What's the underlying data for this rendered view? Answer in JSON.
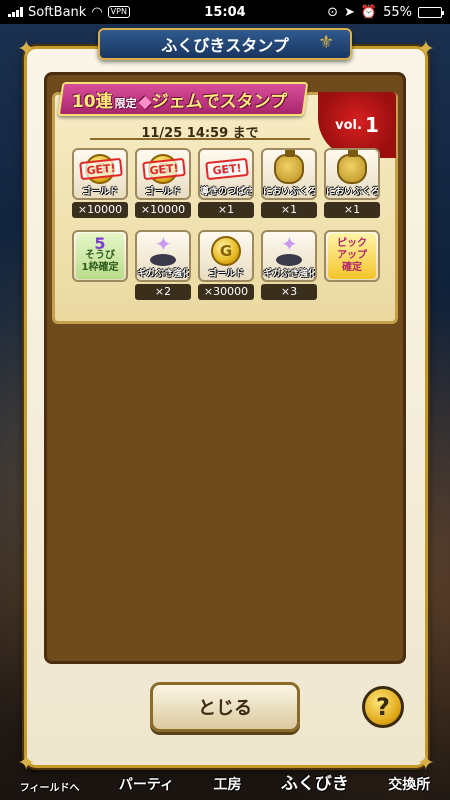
{
  "status_bar": {
    "carrier": "SoftBank",
    "vpn": "VPN",
    "time": "15:04",
    "battery": "55%",
    "battery_level": 0.55
  },
  "dialog": {
    "title": "ふくびきスタンプ",
    "banner": {
      "part1": "10連",
      "part2": "限定",
      "part3": "ジェムでスタンプ"
    },
    "deadline": "11/25 14:59 まで",
    "vol_label": "vol.",
    "vol_number": "1",
    "close_label": "とじる",
    "help_label": "?"
  },
  "stamps": [
    {
      "icon": "gold-coin-icon",
      "got": true,
      "label": "ゴールド",
      "qty": "×10000"
    },
    {
      "icon": "gold-coin-icon",
      "got": true,
      "label": "ゴールド",
      "qty": "×10000"
    },
    {
      "icon": "guiding-wings-icon",
      "got": true,
      "label": "導きのつばさ",
      "qty": "×1"
    },
    {
      "icon": "scent-bag-icon",
      "got": false,
      "label": "においぶくろ",
      "qty": "×1"
    },
    {
      "icon": "scent-bag-icon",
      "got": false,
      "label": "においぶくろ",
      "qty": "×1"
    },
    {
      "icon": "five-star-guarantee-icon",
      "got": false,
      "label": "",
      "qty": ""
    },
    {
      "icon": "giga-upgrade-stone-icon",
      "got": false,
      "label": "ギガぶき強化石",
      "qty": "×2"
    },
    {
      "icon": "gold-coin-icon",
      "got": false,
      "label": "ゴールド",
      "qty": "×30000"
    },
    {
      "icon": "giga-upgrade-stone-icon",
      "got": false,
      "label": "ギガぶき強化石",
      "qty": "×3"
    },
    {
      "icon": "pickup-guarantee-icon",
      "got": false,
      "label": "",
      "qty": ""
    }
  ],
  "stamp_text": {
    "get": "GET!",
    "coin_letter": "G",
    "five_star_num": "5",
    "five_star_line1": "そうび",
    "five_star_line2": "1枠確定",
    "pickup_line1": "ピック",
    "pickup_line2": "アップ",
    "pickup_line3": "確定"
  },
  "bottom_nav": [
    {
      "label": "フィールドへ"
    },
    {
      "label": "パーティ"
    },
    {
      "label": "工房"
    },
    {
      "label": "ふくびき"
    },
    {
      "label": "交換所"
    }
  ],
  "colors": {
    "frame_gold": "#c59b2c",
    "title_blue": "#1a3560",
    "banner_pink": "#a8266c",
    "seal_red": "#d72020"
  }
}
